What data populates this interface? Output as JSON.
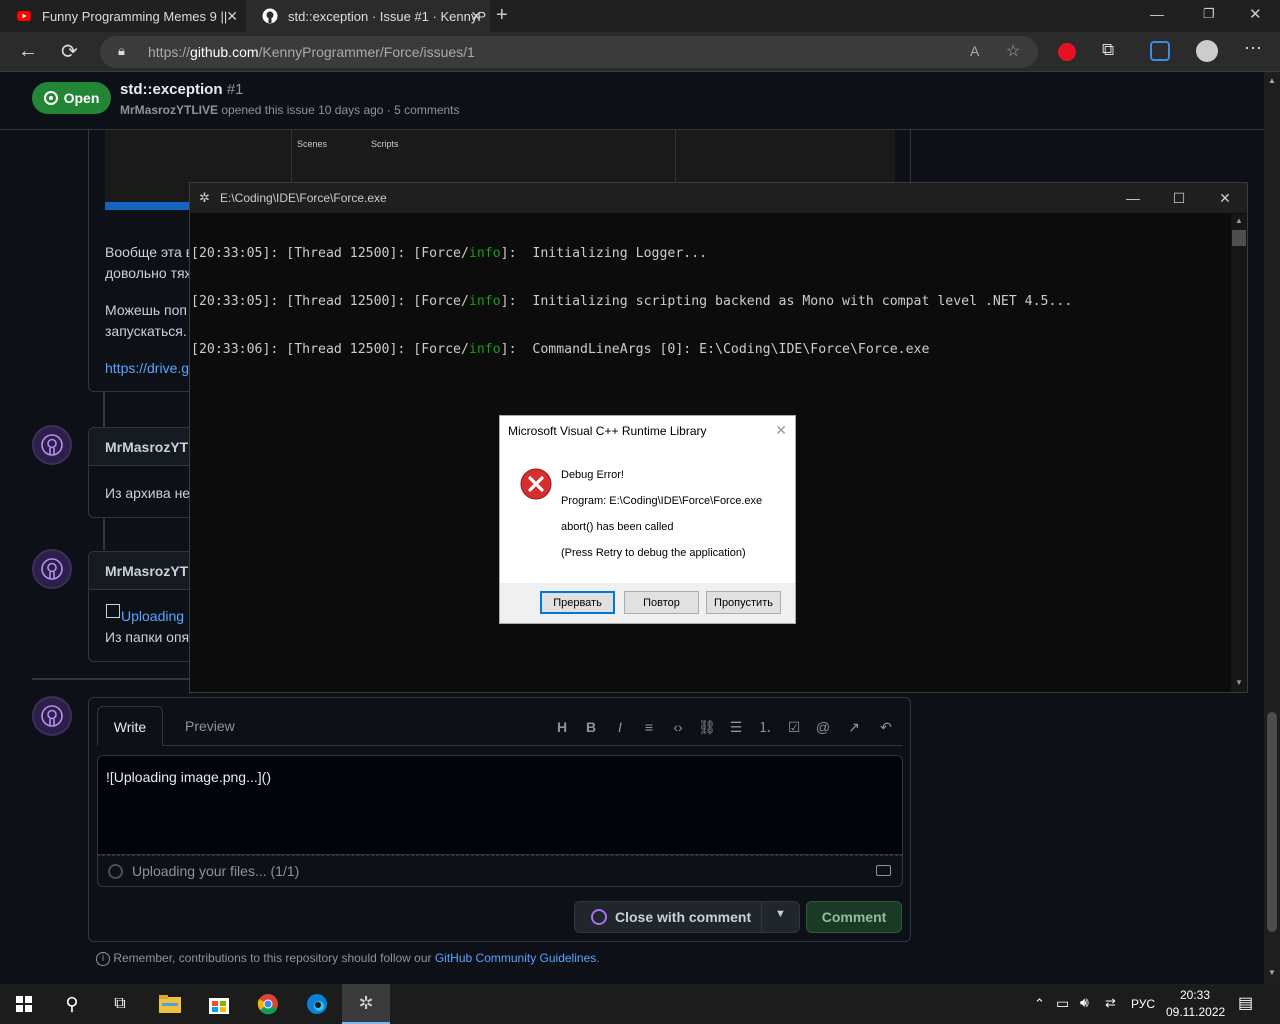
{
  "browser": {
    "tabs": [
      {
        "title": "Funny Programming Memes 9 ||"
      },
      {
        "title": "std::exception · Issue #1 · KennyP"
      }
    ],
    "new_tab": "+",
    "url_prefix": "https://",
    "url_host": "github.com",
    "url_path": "/KennyProgrammer/Force/issues/1"
  },
  "issue": {
    "state": "Open",
    "title": "std::exception",
    "number": "#1",
    "author": "MrMasrozYTLIVE",
    "meta": "opened this issue 10 days ago · 5 comments"
  },
  "screenshot_fragment": {
    "label1": "Scenes",
    "label2": "Scripts"
  },
  "comment1": {
    "line1": "Вообще эта в",
    "line2": "довольно тяж",
    "line3": "Можешь поп",
    "line4": "запускаться.",
    "link": "https://drive.g"
  },
  "comment2": {
    "author": "MrMasrozYTL",
    "text": "Из архива не"
  },
  "comment3": {
    "author": "MrMasrozYTL",
    "link": "Uploading",
    "text": "Из папки опя"
  },
  "console": {
    "title": "E:\\Coding\\IDE\\Force\\Force.exe",
    "lines": [
      {
        "pre": "[20:33:05]: [Thread 12500]: [Force/",
        "lvl": "info",
        "post": "]:  Initializing Logger..."
      },
      {
        "pre": "[20:33:05]: [Thread 12500]: [Force/",
        "lvl": "info",
        "post": "]:  Initializing scripting backend as Mono with compat level .NET 4.5..."
      },
      {
        "pre": "[20:33:06]: [Thread 12500]: [Force/",
        "lvl": "info",
        "post": "]:  CommandLineArgs [0]: E:\\Coding\\IDE\\Force\\Force.exe"
      }
    ]
  },
  "dialog": {
    "title": "Microsoft Visual C++ Runtime Library",
    "heading": "Debug Error!",
    "program": "Program: E:\\Coding\\IDE\\Force\\Force.exe",
    "message": "abort() has been called",
    "hint": "(Press Retry to debug the application)",
    "btn_abort": "Прервать",
    "btn_retry": "Повтор",
    "btn_ignore": "Пропустить"
  },
  "editor": {
    "tab_write": "Write",
    "tab_preview": "Preview",
    "text": "![Uploading image.png...]()",
    "upload_status": "Uploading your files... (1/1)",
    "close_btn": "Close with comment",
    "comment_btn": "Comment",
    "guidelines_prefix": "Remember, contributions to this repository should follow our",
    "guidelines_link": "GitHub Community Guidelines",
    "guidelines_suffix": "."
  },
  "taskbar": {
    "lang": "РУС",
    "time": "20:33",
    "date": "09.11.2022"
  },
  "colors": {
    "open_green": "#238636",
    "info_green": "#13a10e",
    "link_blue": "#58a6ff"
  }
}
